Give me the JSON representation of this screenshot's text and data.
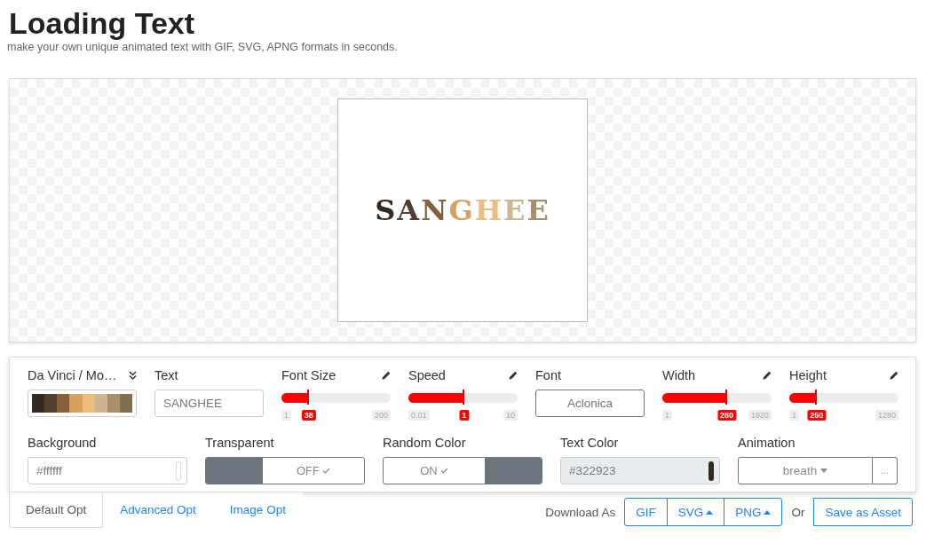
{
  "header": {
    "title": "Loading Text",
    "subtitle": "make your own unique animated text with GIF, SVG, APNG formats in seconds."
  },
  "preview": {
    "text": "SANGHEE"
  },
  "row1": [
    {
      "kind": "palette",
      "label": "Da Vinci / Mo…",
      "swatches": [
        {
          "color": "#352a23"
        },
        {
          "color": "#523f2f"
        },
        {
          "color": "#875f3a"
        },
        {
          "color": "#d8a05f"
        },
        {
          "color": "#ebbe7f"
        },
        {
          "color": "#cdb494"
        },
        {
          "color": "#a88e6a"
        },
        {
          "color": "#80704f"
        }
      ]
    },
    {
      "kind": "input",
      "label": "Text",
      "value": "SANGHEE"
    },
    {
      "kind": "slider",
      "label": "Font Size",
      "level": 0.25,
      "min": "1",
      "value": "38",
      "max": "200"
    },
    {
      "kind": "slider",
      "label": "Speed",
      "level": 0.51,
      "min": "0.01",
      "value": "1",
      "max": "10"
    },
    {
      "kind": "button",
      "label": "Font",
      "value": "Aclonica"
    },
    {
      "kind": "slider",
      "label": "Width",
      "level": 0.59,
      "min": "1",
      "value": "280",
      "max": "1920"
    },
    {
      "kind": "slider",
      "label": "Height",
      "level": 0.25,
      "min": "1",
      "value": "250",
      "max": "1280"
    }
  ],
  "row2": [
    {
      "kind": "color",
      "label": "Background",
      "value": "#ffffff",
      "color": "#ffffff"
    },
    {
      "kind": "toggle",
      "label": "Transparent",
      "on": false,
      "text": "OFF"
    },
    {
      "kind": "toggle",
      "label": "Random Color",
      "on": true,
      "text": "ON"
    },
    {
      "kind": "color",
      "label": "Text Color",
      "value": "#322923",
      "color": "#322923",
      "disabled": true
    },
    {
      "kind": "select",
      "label": "Animation",
      "value": "breath",
      "more": "..."
    }
  ],
  "tabs": [
    {
      "label": "Default Opt",
      "selected": true
    },
    {
      "label": "Advanced Opt",
      "selected": false
    },
    {
      "label": "Image Opt",
      "selected": false
    }
  ],
  "download": {
    "label": "Download As",
    "formats": [
      {
        "label": "GIF",
        "menu": false
      },
      {
        "label": "SVG",
        "menu": true
      },
      {
        "label": "PNG",
        "menu": true
      }
    ],
    "or": "Or",
    "save": "Save as Asset"
  }
}
